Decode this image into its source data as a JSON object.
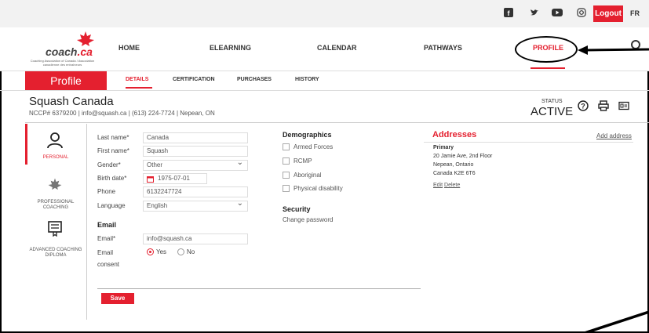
{
  "topbar": {
    "icons": [
      "facebook-icon",
      "twitter-icon",
      "youtube-icon",
      "instagram-icon"
    ],
    "logout_label": "Logout",
    "language_label": "FR"
  },
  "logo": {
    "text_coach": "coach",
    "text_ca": ".ca",
    "subtitle": "Coaching Association of Canada / Association canadienne des entraîneurs"
  },
  "nav": {
    "items": [
      "HOME",
      "ELEARNING",
      "CALENDAR",
      "PATHWAYS",
      "PROFILE"
    ],
    "active": "PROFILE"
  },
  "subnav": {
    "section_title": "Profile",
    "tabs": [
      "DETAILS",
      "CERTIFICATION",
      "PURCHASES",
      "HISTORY"
    ],
    "active": "DETAILS"
  },
  "org": {
    "name": "Squash Canada",
    "contact": "NCCP# 6379200  |  info@squash.ca  |  (613) 224-7724  |  Nepean, ON",
    "status_label": "STATUS",
    "status_value": "ACTIVE"
  },
  "sidebar": {
    "items": [
      {
        "label": "PERSONAL",
        "icon": "person-icon"
      },
      {
        "label": "PROFESSIONAL COACHING",
        "icon": "maple-leaf-icon"
      },
      {
        "label": "ADVANCED COACHING DIPLOMA",
        "icon": "diploma-icon"
      }
    ]
  },
  "form": {
    "last_name_label": "Last name*",
    "last_name_value": "Canada",
    "first_name_label": "First name*",
    "first_name_value": "Squash",
    "gender_label": "Gender*",
    "gender_value": "Other",
    "birth_label": "Birth date*",
    "birth_value": "1975-07-01",
    "phone_label": "Phone",
    "phone_value": "6132247724",
    "language_label": "Language",
    "language_value": "English",
    "email_section": "Email",
    "email_label": "Email*",
    "email_value": "info@squash.ca",
    "consent_label_1": "Email",
    "consent_label_2": "consent",
    "consent_yes": "Yes",
    "consent_no": "No",
    "save_label": "Save"
  },
  "demographics": {
    "title": "Demographics",
    "options": [
      "Armed Forces",
      "RCMP",
      "Aboriginal",
      "Physical disability"
    ]
  },
  "security": {
    "title": "Security",
    "change_password": "Change password"
  },
  "addresses": {
    "title": "Addresses",
    "add_label": "Add address",
    "type": "Primary",
    "line1": "20 Jamie Ave, 2nd Floor",
    "line2": "Nepean, Ontario",
    "line3": "Canada K2E 6T6",
    "edit_label": "Edit",
    "delete_label": "Delete"
  },
  "colors": {
    "accent": "#e4202f"
  }
}
